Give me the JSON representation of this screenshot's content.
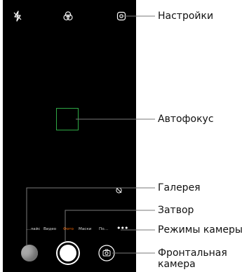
{
  "camera_screen": {
    "top_bar": {
      "flash_icon": "flash-off-icon",
      "filter_icon": "filters-icon",
      "settings_icon": "settings-gear-icon"
    },
    "mode_labels": [
      "…лайс",
      "Видео",
      "Фото",
      "Маски",
      "По…"
    ],
    "active_mode": "Фото",
    "more_icon": "•••",
    "colors": {
      "background": "#000000",
      "focus_frame": "#2fa845",
      "active_mode": "#ff6a00",
      "shutter": "#ffffff"
    }
  },
  "callouts": {
    "settings": "Настройки",
    "autofocus": "Автофокус",
    "gallery": "Галерея",
    "shutter": "Затвор",
    "camera_modes": "Режимы камеры",
    "front_camera_line1": "Фронтальная",
    "front_camera_line2": "камера"
  }
}
